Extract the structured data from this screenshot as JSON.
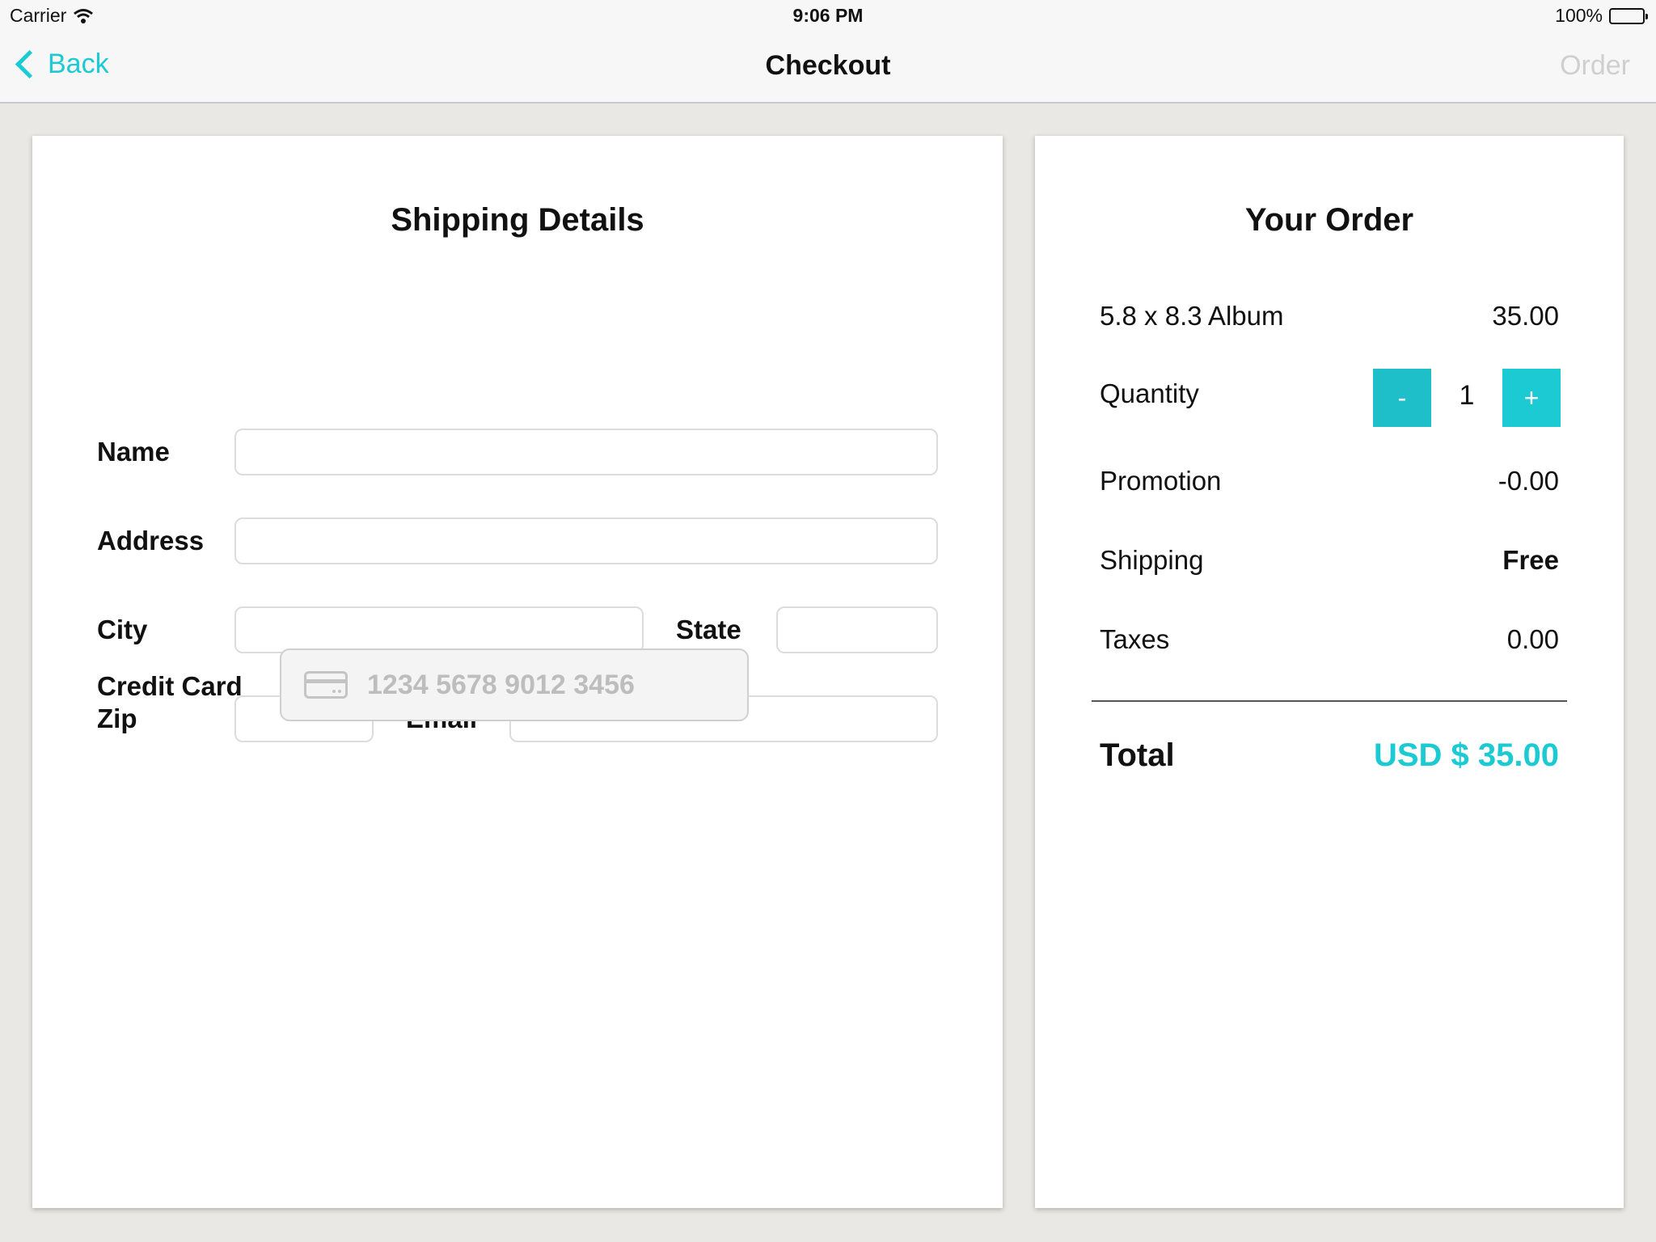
{
  "status_bar": {
    "carrier": "Carrier",
    "wifi_icon": "wifi-icon",
    "time": "9:06 PM",
    "battery": "100%"
  },
  "nav": {
    "back_label": "Back",
    "title": "Checkout",
    "order_label": "Order",
    "accent_color": "#1ccad4",
    "disabled_color": "#cfcfcf"
  },
  "shipping": {
    "title": "Shipping Details",
    "name_label": "Name",
    "address_label": "Address",
    "city_label": "City",
    "state_label": "State",
    "zip_label": "Zip",
    "email_label": "Email",
    "credit_card_label": "Credit Card",
    "credit_card_placeholder": "1234 5678 9012 3456",
    "credit_card_icon": "credit-card-icon"
  },
  "order": {
    "title": "Your Order",
    "item_label": "5.8 x 8.3 Album",
    "item_price": "35.00",
    "quantity_label": "Quantity",
    "quantity_minus": "-",
    "quantity_value": "1",
    "quantity_plus": "+",
    "promotion_label": "Promotion",
    "promotion_value": "-0.00",
    "shipping_label": "Shipping",
    "shipping_value": "Free",
    "taxes_label": "Taxes",
    "taxes_value": "0.00",
    "total_label": "Total",
    "total_value": "USD $ 35.00"
  }
}
